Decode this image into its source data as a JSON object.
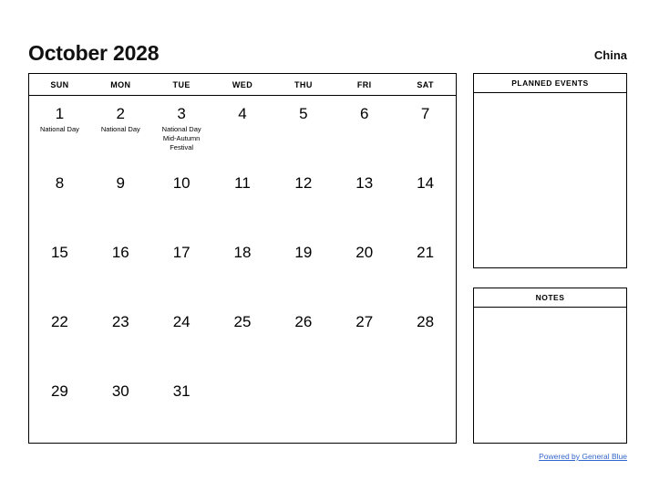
{
  "header": {
    "title": "October 2028",
    "country": "China"
  },
  "calendar": {
    "weekday_headers": [
      "SUN",
      "MON",
      "TUE",
      "WED",
      "THU",
      "FRI",
      "SAT"
    ],
    "weeks": [
      [
        {
          "num": "1",
          "events": [
            "National Day"
          ]
        },
        {
          "num": "2",
          "events": [
            "National Day"
          ]
        },
        {
          "num": "3",
          "events": [
            "National Day",
            "Mid-Autumn Festival"
          ]
        },
        {
          "num": "4",
          "events": []
        },
        {
          "num": "5",
          "events": []
        },
        {
          "num": "6",
          "events": []
        },
        {
          "num": "7",
          "events": []
        }
      ],
      [
        {
          "num": "8",
          "events": []
        },
        {
          "num": "9",
          "events": []
        },
        {
          "num": "10",
          "events": []
        },
        {
          "num": "11",
          "events": []
        },
        {
          "num": "12",
          "events": []
        },
        {
          "num": "13",
          "events": []
        },
        {
          "num": "14",
          "events": []
        }
      ],
      [
        {
          "num": "15",
          "events": []
        },
        {
          "num": "16",
          "events": []
        },
        {
          "num": "17",
          "events": []
        },
        {
          "num": "18",
          "events": []
        },
        {
          "num": "19",
          "events": []
        },
        {
          "num": "20",
          "events": []
        },
        {
          "num": "21",
          "events": []
        }
      ],
      [
        {
          "num": "22",
          "events": []
        },
        {
          "num": "23",
          "events": []
        },
        {
          "num": "24",
          "events": []
        },
        {
          "num": "25",
          "events": []
        },
        {
          "num": "26",
          "events": []
        },
        {
          "num": "27",
          "events": []
        },
        {
          "num": "28",
          "events": []
        }
      ],
      [
        {
          "num": "29",
          "events": []
        },
        {
          "num": "30",
          "events": []
        },
        {
          "num": "31",
          "events": []
        },
        {
          "num": "",
          "events": []
        },
        {
          "num": "",
          "events": []
        },
        {
          "num": "",
          "events": []
        },
        {
          "num": "",
          "events": []
        }
      ]
    ]
  },
  "sidebar": {
    "planned_events": {
      "title": "PLANNED EVENTS",
      "content": ""
    },
    "notes": {
      "title": "NOTES",
      "content": ""
    }
  },
  "footer": {
    "link_label": "Powered by General Blue"
  },
  "colors": {
    "link": "#3366cc",
    "border": "#000000",
    "text": "#000000",
    "background": "#ffffff"
  }
}
